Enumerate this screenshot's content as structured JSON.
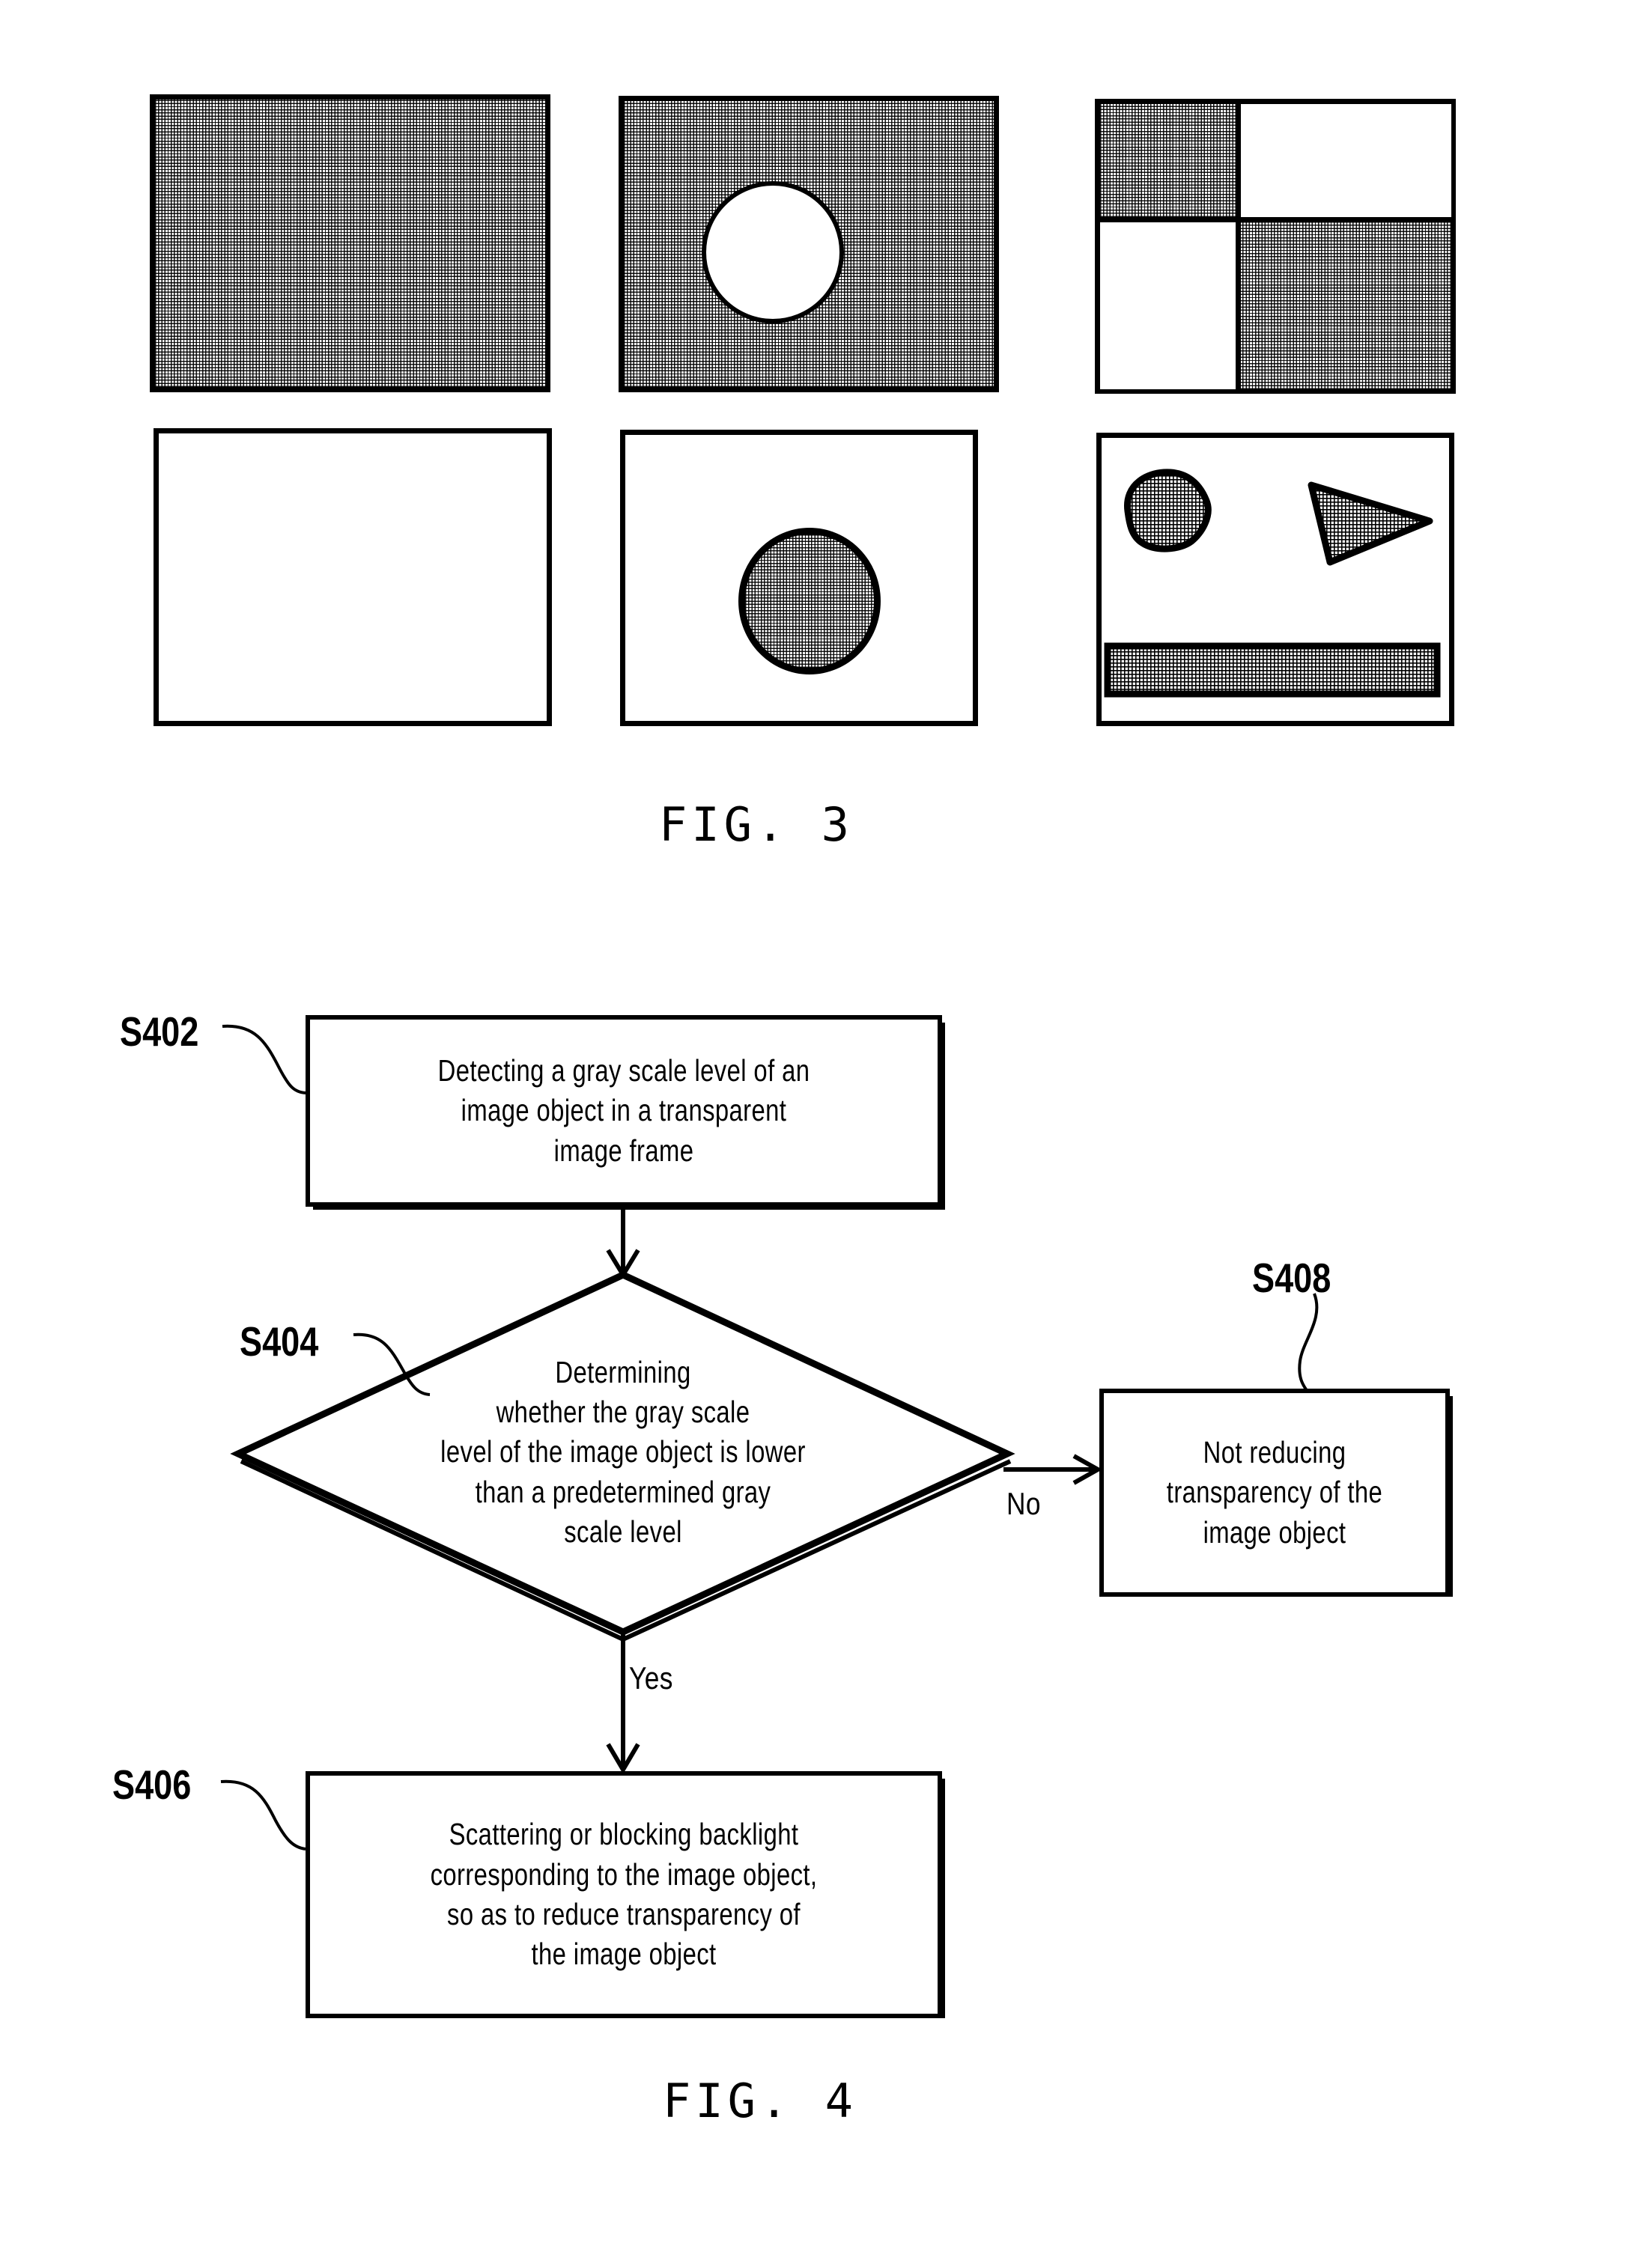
{
  "figure3": {
    "caption": "FIG. 3",
    "panels": [
      {
        "id": "p1",
        "name": "fully-hatched-frame",
        "description": "solid gray scale fill covering entire frame"
      },
      {
        "id": "p2",
        "name": "hatched-frame-with-white-circle",
        "description": "gray scale fill with white circular hole"
      },
      {
        "id": "p3",
        "name": "checkerboard-quadrant-frame",
        "description": "four quadrants, top-left and bottom-right hatched"
      },
      {
        "id": "p4",
        "name": "empty-frame",
        "description": "blank transparent image frame"
      },
      {
        "id": "p5",
        "name": "frame-with-hatched-circle",
        "description": "blank frame containing one hatched circle object"
      },
      {
        "id": "p6",
        "name": "frame-with-three-objects",
        "description": "blank frame containing a hatched blob, a hatched triangle and a hatched bar"
      }
    ]
  },
  "figure4": {
    "caption": "FIG. 4",
    "steps": [
      {
        "id": "S402",
        "label": "S402",
        "shape": "process",
        "text": "Detecting a gray scale level of an\nimage object in a transparent\nimage frame"
      },
      {
        "id": "S404",
        "label": "S404",
        "shape": "decision",
        "text": "Determining\nwhether the gray scale\nlevel of the image object is lower\nthan a predetermined gray\nscale level"
      },
      {
        "id": "S406",
        "label": "S406",
        "shape": "process",
        "text": "Scattering or blocking backlight\ncorresponding to the image object,\nso as to reduce transparency of\nthe image object"
      },
      {
        "id": "S408",
        "label": "S408",
        "shape": "process",
        "text": "Not reducing\ntransparency of the\nimage object"
      }
    ],
    "branches": [
      {
        "id": "no-branch",
        "label": "No",
        "from": "S404",
        "to": "S408"
      },
      {
        "id": "yes-branch",
        "label": "Yes",
        "from": "S404",
        "to": "S406"
      }
    ]
  },
  "colors": {
    "ink": "#000000",
    "paper": "#ffffff"
  }
}
